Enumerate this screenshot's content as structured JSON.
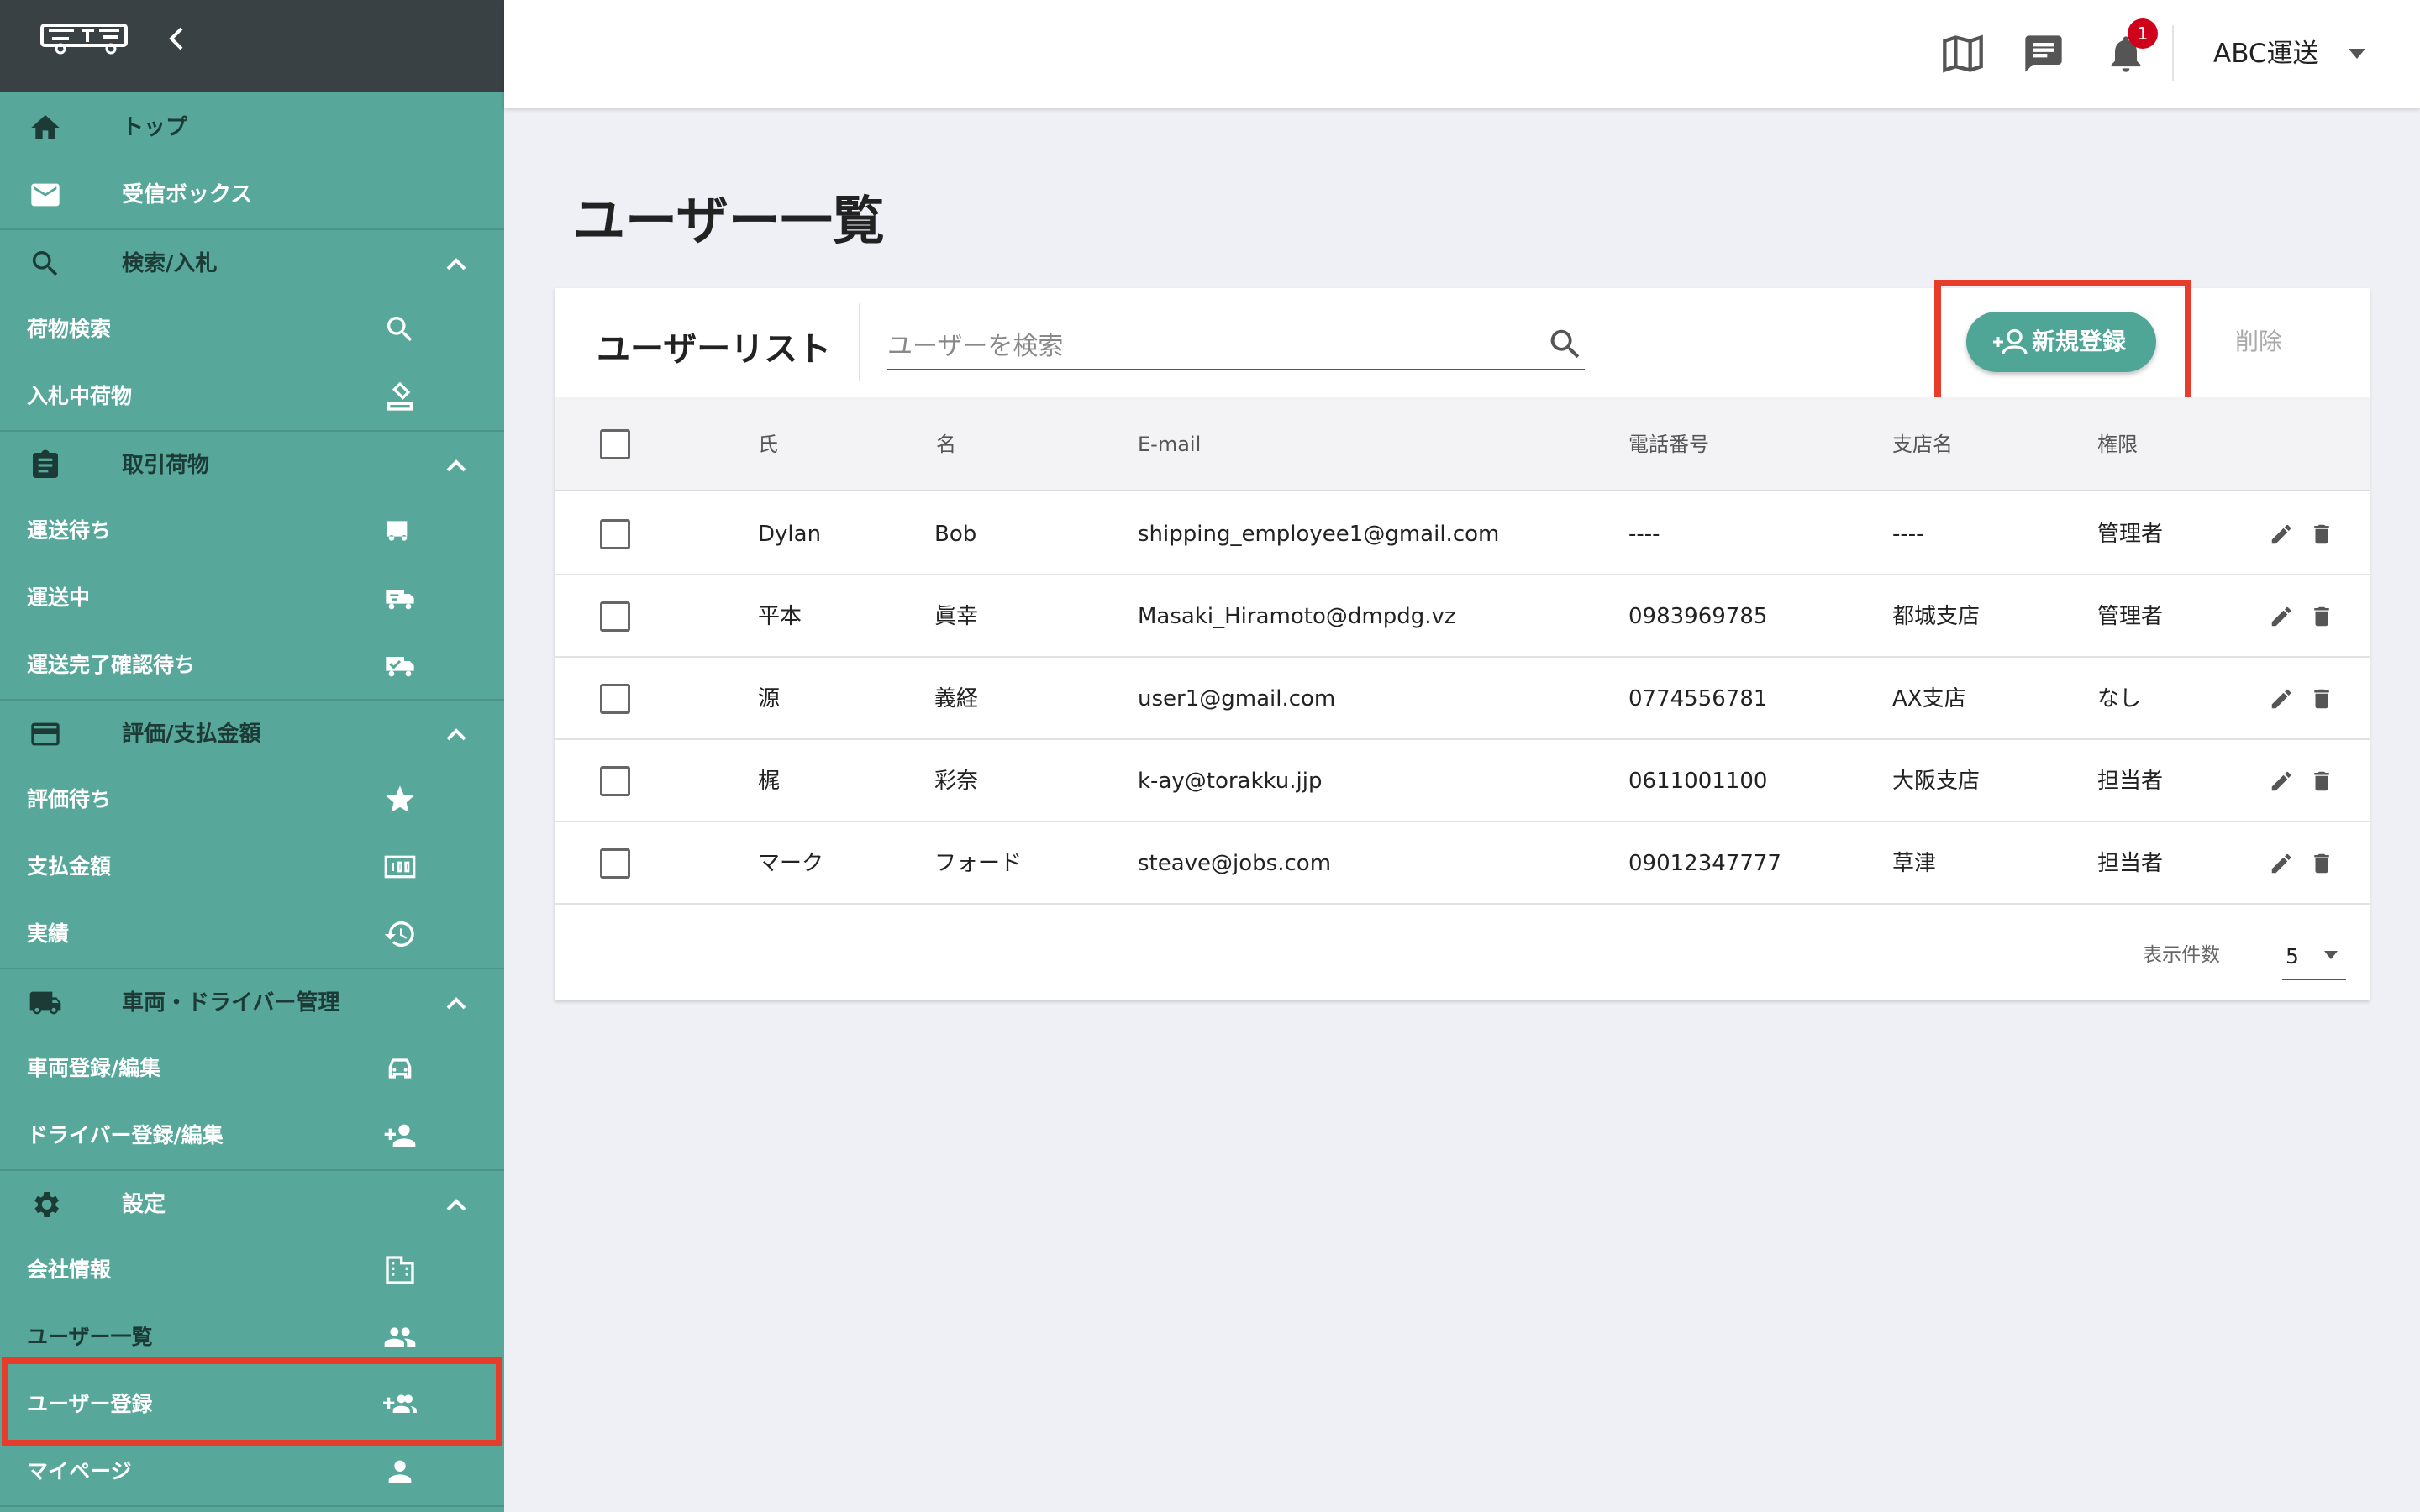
{
  "colors": {
    "sidebar": "#57a79a",
    "sidebar_head": "#394144",
    "accent": "#4fa596",
    "highlight": "#e63c29",
    "badge": "#d0021b"
  },
  "sidebar": {
    "sections": [
      {
        "label": "トップ",
        "icon": "home-icon",
        "type": "item"
      },
      {
        "label": "受信ボックス",
        "icon": "mail-icon",
        "type": "item"
      },
      {
        "label": "検索/入札",
        "icon": "search-icon",
        "type": "group",
        "items": [
          {
            "label": "荷物検索",
            "icon": "search-icon"
          },
          {
            "label": "入札中荷物",
            "icon": "gavel-icon"
          }
        ]
      },
      {
        "label": "取引荷物",
        "icon": "clipboard-icon",
        "type": "group",
        "items": [
          {
            "label": "運送待ち",
            "icon": "truck-icon"
          },
          {
            "label": "運送中",
            "icon": "truck-fast-icon"
          },
          {
            "label": "運送完了確認待ち",
            "icon": "truck-check-icon"
          }
        ]
      },
      {
        "label": "評価/支払金額",
        "icon": "credit-card-icon",
        "type": "group",
        "items": [
          {
            "label": "評価待ち",
            "icon": "star-icon"
          },
          {
            "label": "支払金額",
            "icon": "money-icon"
          },
          {
            "label": "実績",
            "icon": "history-icon"
          }
        ]
      },
      {
        "label": "車両・ドライバー管理",
        "icon": "truck-icon",
        "type": "group",
        "items": [
          {
            "label": "車両登録/編集",
            "icon": "car-icon"
          },
          {
            "label": "ドライバー登録/編集",
            "icon": "person-add-icon"
          }
        ]
      },
      {
        "label": "設定",
        "icon": "gear-icon",
        "type": "group",
        "items": [
          {
            "label": "会社情報",
            "icon": "building-icon"
          },
          {
            "label": "ユーザー一覧",
            "icon": "group-icon"
          },
          {
            "label": "ユーザー登録",
            "icon": "group-add-icon"
          },
          {
            "label": "マイページ",
            "icon": "person-icon"
          }
        ]
      }
    ]
  },
  "header": {
    "notification_count": "1",
    "company": "ABC運送"
  },
  "page": {
    "title": "ユーザー一覧"
  },
  "card": {
    "title": "ユーザーリスト",
    "search_placeholder": "ユーザーを検索",
    "new_button": "新規登録",
    "delete_button": "削除"
  },
  "table": {
    "columns": [
      "氏",
      "名",
      "E-mail",
      "電話番号",
      "支店名",
      "権限"
    ],
    "rows": [
      [
        "Dylan",
        "Bob",
        "shipping_employee1@gmail.com",
        "----",
        "----",
        "管理者"
      ],
      [
        "平本",
        "眞幸",
        "Masaki_Hiramoto@dmpdg.vz",
        "0983969785",
        "都城支店",
        "管理者"
      ],
      [
        "源",
        "義経",
        "user1@gmail.com",
        "0774556781",
        "AX支店",
        "なし"
      ],
      [
        "梶",
        "彩奈",
        "k-ay@torakku.jjp",
        "0611001100",
        "大阪支店",
        "担当者"
      ],
      [
        "マーク",
        "フォード",
        "steave@jobs.com",
        "09012347777",
        "草津",
        "担当者"
      ]
    ]
  },
  "pager": {
    "label": "表示件数",
    "value": "5"
  }
}
